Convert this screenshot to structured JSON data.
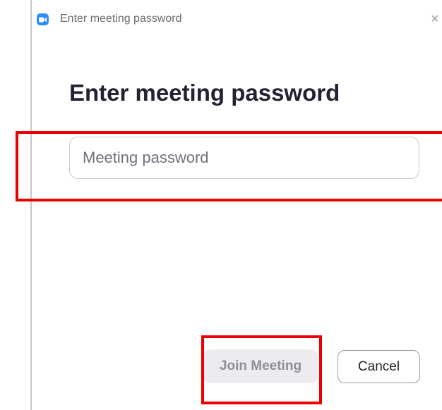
{
  "window": {
    "title": "Enter meeting password",
    "close_glyph": "×",
    "app_icon": "zoom-camera-icon",
    "app_icon_color": "#2d8cff"
  },
  "dialog": {
    "heading": "Enter meeting password",
    "password_field": {
      "value": "",
      "placeholder": "Meeting password"
    },
    "buttons": {
      "join_label": "Join Meeting",
      "cancel_label": "Cancel"
    }
  },
  "colors": {
    "highlight": "#ee0000",
    "accent": "#2d8cff",
    "disabled_button_bg": "#ececf0",
    "disabled_button_text": "#8e8e98"
  }
}
